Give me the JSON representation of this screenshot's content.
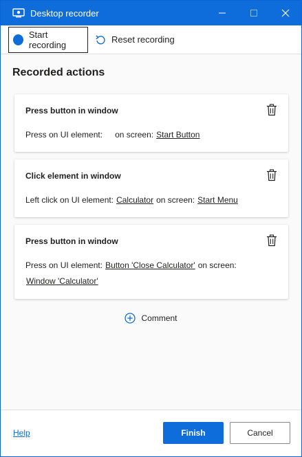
{
  "window": {
    "title": "Desktop recorder",
    "controls": {
      "minimize": "—",
      "maximize": "☐",
      "close": "✕"
    }
  },
  "toolbar": {
    "start_label": "Start recording",
    "reset_label": "Reset recording"
  },
  "main": {
    "section_title": "Recorded actions",
    "actions": [
      {
        "title": "Press button in window",
        "line1": {
          "prefix": "Press on UI element:",
          "element": "",
          "mid": "on screen:",
          "screen": "Start Button"
        }
      },
      {
        "title": "Click element in window",
        "line1": {
          "prefix": "Left click on UI element:",
          "element": "Calculator",
          "mid": "on screen:",
          "screen": "Start Menu"
        }
      },
      {
        "title": "Press button in window",
        "line1": {
          "prefix": "Press on UI element:",
          "element": "Button 'Close Calculator'",
          "mid": "on screen:"
        },
        "line2": {
          "screen": "Window 'Calculator'"
        }
      }
    ],
    "comment_label": "Comment"
  },
  "footer": {
    "help_label": "Help",
    "finish_label": "Finish",
    "cancel_label": "Cancel"
  },
  "colors": {
    "accent": "#0f6cdb",
    "text": "#201f1e",
    "divider": "#e1dfdd"
  },
  "icons": {
    "app": "monitor-icon",
    "record": "record-dot-icon",
    "reset": "undo-arrow-icon",
    "delete": "trash-icon",
    "comment": "add-circle-icon"
  }
}
